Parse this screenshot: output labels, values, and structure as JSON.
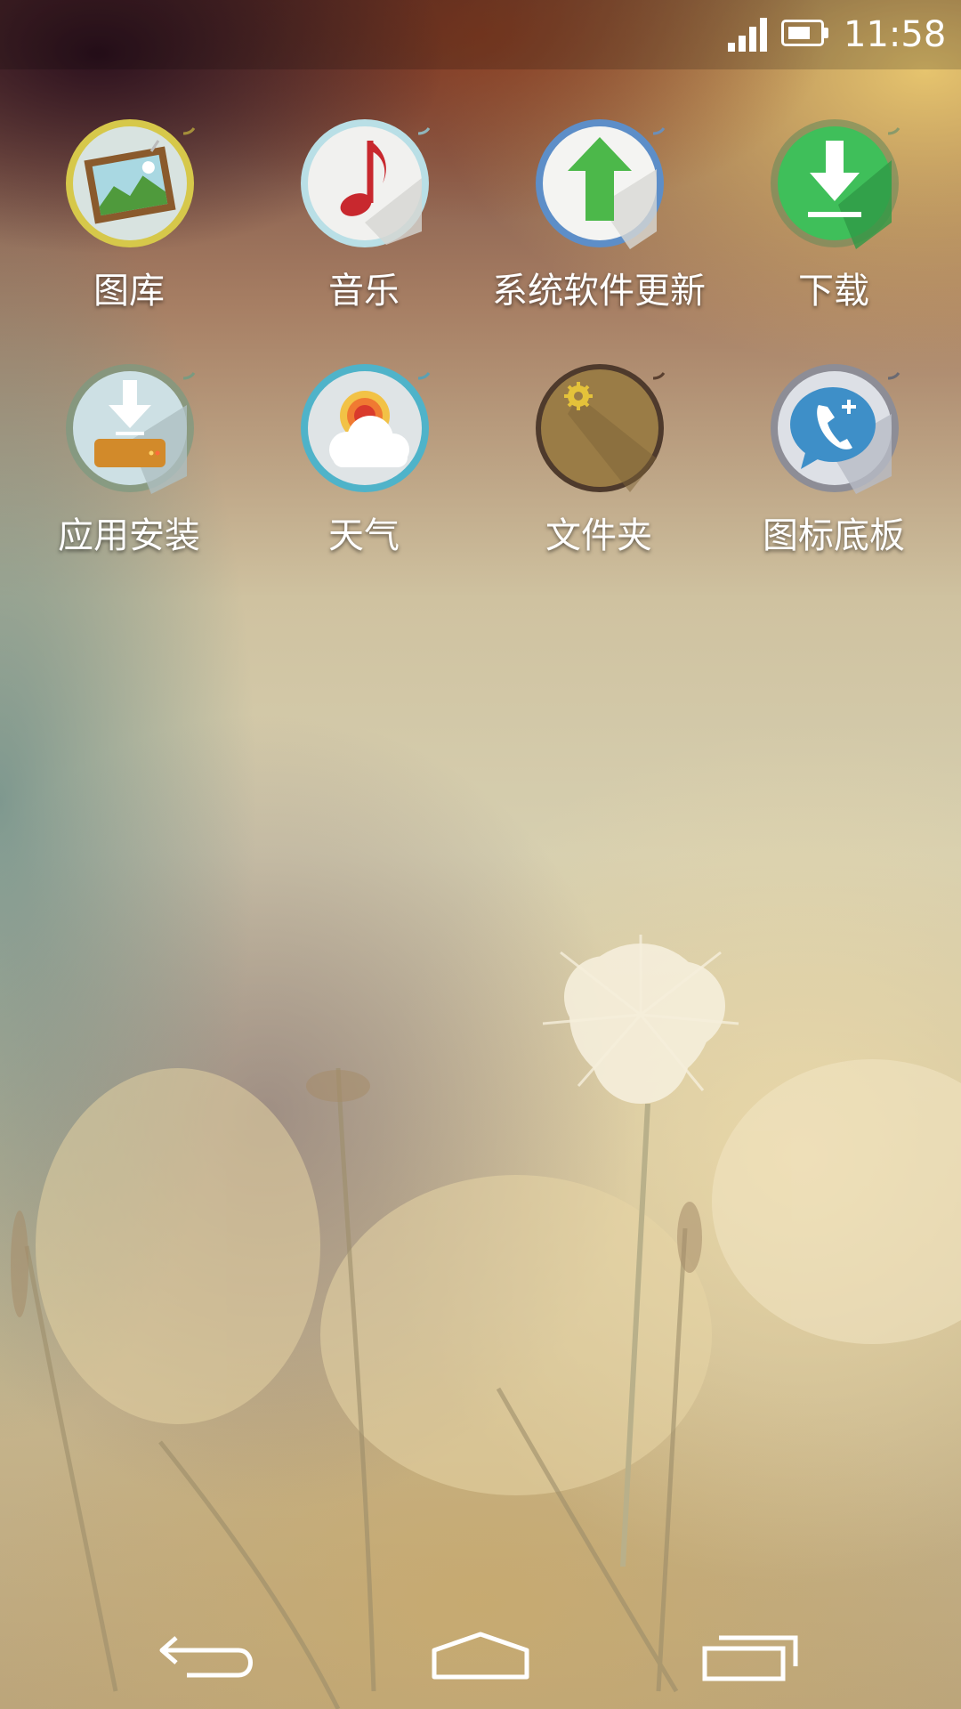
{
  "status_bar": {
    "time": "11:58",
    "signal_icon": "signal-icon",
    "battery_icon": "battery-icon"
  },
  "apps": [
    {
      "label": "图库",
      "icon": "gallery-icon"
    },
    {
      "label": "音乐",
      "icon": "music-icon"
    },
    {
      "label": "系统软件更新",
      "icon": "system-update-icon"
    },
    {
      "label": "下载",
      "icon": "download-icon"
    },
    {
      "label": "应用安装",
      "icon": "app-install-icon"
    },
    {
      "label": "天气",
      "icon": "weather-icon"
    },
    {
      "label": "文件夹",
      "icon": "folder-icon"
    },
    {
      "label": "图标底板",
      "icon": "icon-base-icon"
    }
  ],
  "nav_bar": {
    "back_icon": "back-icon",
    "home_icon": "home-icon",
    "recents_icon": "recents-icon"
  },
  "colors": {
    "label_text": "#ffffff",
    "download_green": "#3fbf5a",
    "update_green": "#4cb84a",
    "music_red": "#c8282e",
    "folder_brown": "#9a7c46",
    "phone_blue": "#3e8fc8"
  }
}
